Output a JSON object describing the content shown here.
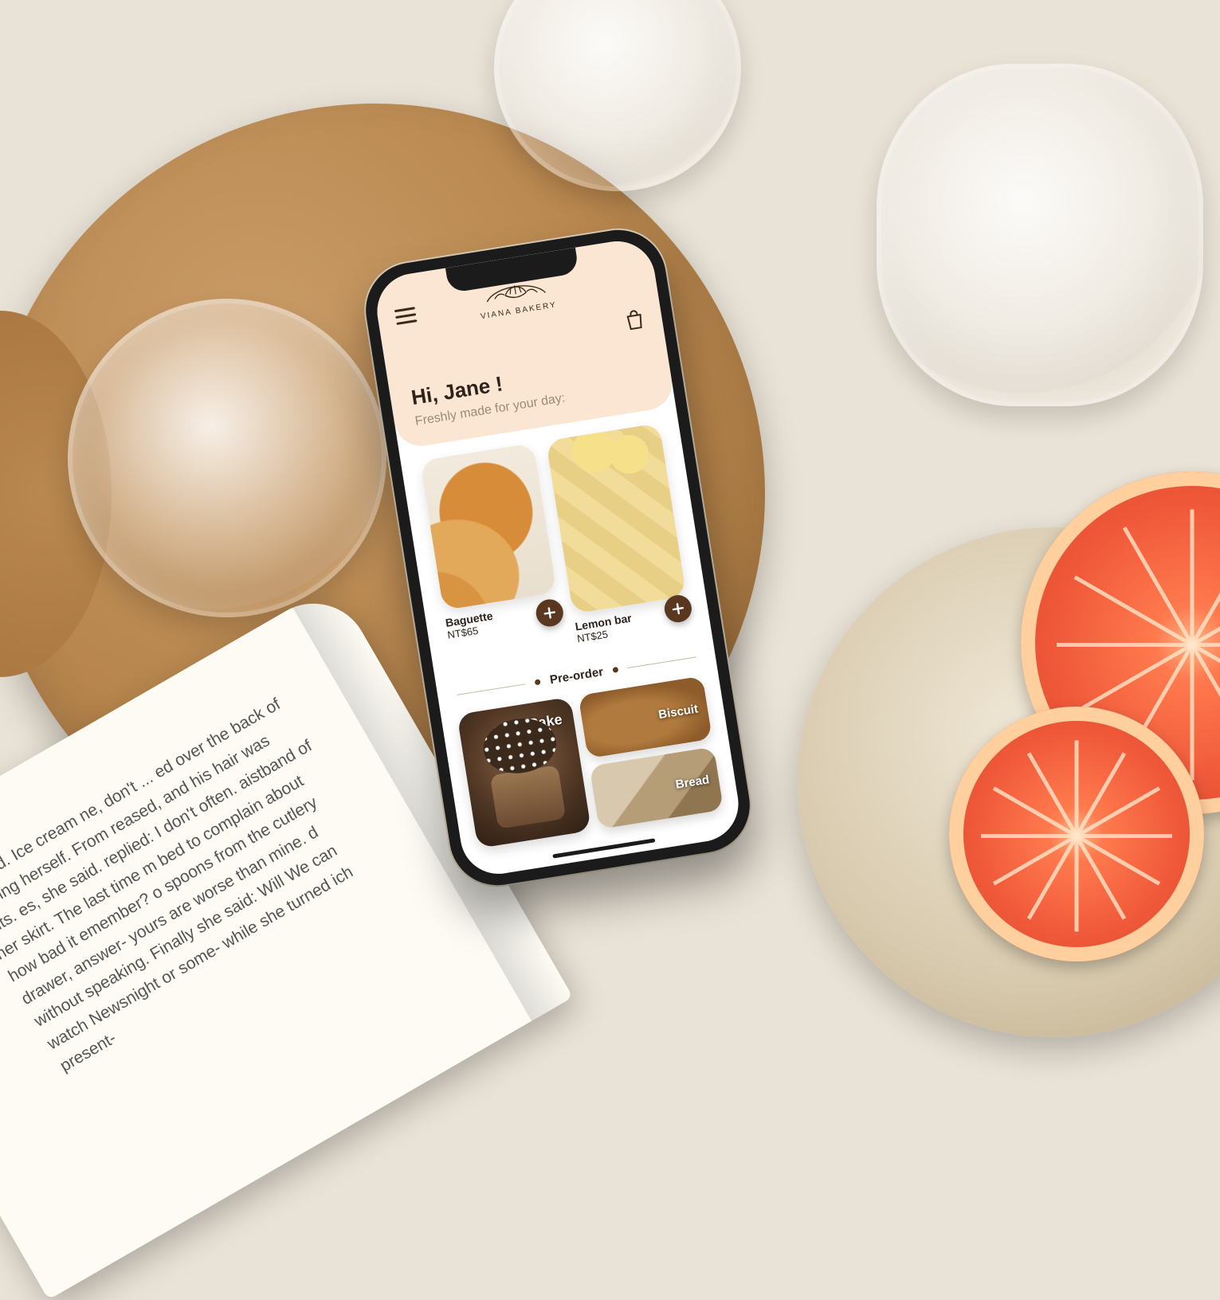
{
  "brand": {
    "name": "VIANA BAKERY"
  },
  "header": {
    "icons": {
      "menu": "menu-icon",
      "bag": "bag-icon"
    }
  },
  "hero": {
    "greeting": "Hi, Jane !",
    "subtitle": "Freshly made for your day:"
  },
  "featured": [
    {
      "name": "Baguette",
      "price": "NT$65",
      "add_label": "+"
    },
    {
      "name": "Lemon bar",
      "price": "NT$25",
      "add_label": "+"
    }
  ],
  "preorder": {
    "heading": "Pre-order",
    "categories": [
      {
        "label": "Cake"
      },
      {
        "label": "Biscuit"
      },
      {
        "label": "Bread"
      }
    ]
  },
  "colors": {
    "peach": "#fbe6d3",
    "brown": "#5a371f",
    "text": "#2e231a"
  },
  "scene": {
    "book_excerpt": "he said. Ice cream ne, don't ... ed over the back of ressing herself. From reased, and his hair was ghts. es, she said. replied: I don't often. aistband of her skirt. The last time m bed to complain about how bad it emember? o spoons from the cutlery drawer, answer- yours are worse than mine. d without speaking. Finally she said: Will We can watch Newsnight or some- while she turned ich present-"
  }
}
